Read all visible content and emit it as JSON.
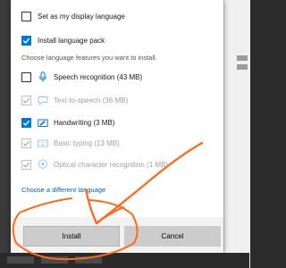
{
  "dialog": {
    "options": [
      {
        "label": "Set as my display language",
        "checked": false,
        "disabled": false
      },
      {
        "label": "Install language pack",
        "checked": true,
        "disabled": false
      }
    ],
    "section_label": "Choose language features you want to install.",
    "features": [
      {
        "label": "Speech recognition (43 MB)",
        "checked": false,
        "disabled": false,
        "icon": "microphone-icon"
      },
      {
        "label": "Text-to-speech (36 MB)",
        "checked": true,
        "disabled": true,
        "icon": "speech-bubble-icon"
      },
      {
        "label": "Handwriting (3 MB)",
        "checked": true,
        "disabled": false,
        "icon": "handwriting-icon"
      },
      {
        "label": "Basic typing (13 MB)",
        "checked": true,
        "disabled": true,
        "icon": "keyboard-icon"
      },
      {
        "label": "Optical character recognition (1 MB)",
        "checked": true,
        "disabled": true,
        "icon": "ocr-eye-icon"
      }
    ],
    "link_label": "Choose a different language",
    "buttons": {
      "install": "Install",
      "cancel": "Cancel"
    }
  },
  "colors": {
    "accent": "#0078d4",
    "link": "#0063b1",
    "annotation": "#ff6a1a",
    "disabled_text": "#a0a0a0"
  }
}
